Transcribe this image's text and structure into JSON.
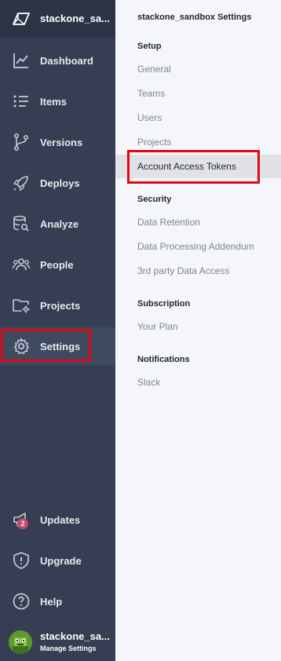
{
  "workspace": {
    "name": "stackone_sa..."
  },
  "sidebar": {
    "items": [
      {
        "label": "Dashboard",
        "icon": "chart-line-icon"
      },
      {
        "label": "Items",
        "icon": "list-icon"
      },
      {
        "label": "Versions",
        "icon": "git-branch-icon"
      },
      {
        "label": "Deploys",
        "icon": "rocket-icon"
      },
      {
        "label": "Analyze",
        "icon": "database-search-icon"
      },
      {
        "label": "People",
        "icon": "people-icon"
      },
      {
        "label": "Projects",
        "icon": "folder-gear-icon"
      },
      {
        "label": "Settings",
        "icon": "gear-icon"
      }
    ],
    "bottom_items": [
      {
        "label": "Updates",
        "icon": "megaphone-icon",
        "badge": "2"
      },
      {
        "label": "Upgrade",
        "icon": "shield-icon"
      },
      {
        "label": "Help",
        "icon": "question-icon"
      }
    ],
    "profile": {
      "name": "stackone_sa...",
      "subtitle": "Manage Settings"
    }
  },
  "settings_panel": {
    "title": "stackone_sandbox Settings",
    "sections": [
      {
        "header": "Setup",
        "items": [
          "General",
          "Teams",
          "Users",
          "Projects",
          "Account Access Tokens"
        ]
      },
      {
        "header": "Security",
        "items": [
          "Data Retention",
          "Data Processing Addendum",
          "3rd party Data Access"
        ]
      },
      {
        "header": "Subscription",
        "items": [
          "Your Plan"
        ]
      },
      {
        "header": "Notifications",
        "items": [
          "Slack"
        ]
      }
    ],
    "selected_item": "Account Access Tokens"
  },
  "colors": {
    "sidebar_bg": "#353e52",
    "panel_bg": "#f5f6fa",
    "highlight_red": "#e30613",
    "badge": "#c44a6a"
  }
}
